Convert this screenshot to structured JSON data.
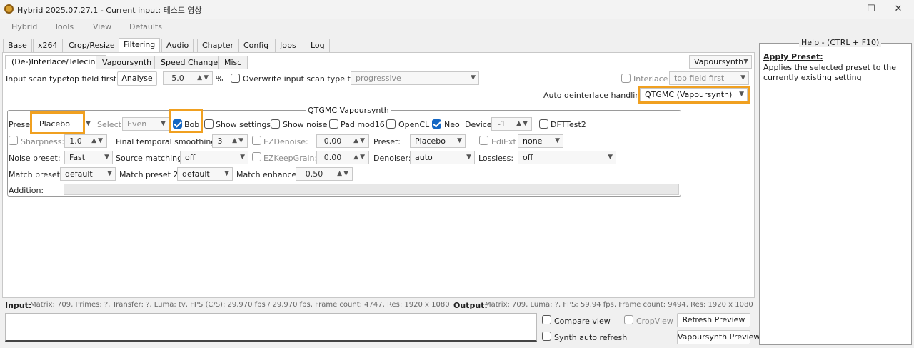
{
  "window": {
    "title": "Hybrid 2025.07.27.1 - Current input: 테스트 영상",
    "minimize": "—",
    "maximize": "☐",
    "close": "✕"
  },
  "menu": [
    "Hybrid",
    "Tools",
    "View",
    "Defaults"
  ],
  "main_tabs": [
    "Base",
    "x264",
    "Crop/Resize",
    "Filtering",
    "Audio",
    "Chapter",
    "Config",
    "Jobs",
    "Log"
  ],
  "sub_tabs": [
    "(De-)Interlace/Telecine",
    "Vapoursynth",
    "Speed Change",
    "Misc"
  ],
  "engine_select": "Vapoursynth",
  "scan": {
    "label": "Input scan type:",
    "value": "top field first",
    "analyse": "Analyse",
    "pct": "5.0",
    "pct_unit": "%",
    "overwrite_label": "Overwrite input scan type to:",
    "overwrite_value": "progressive",
    "interlace_label": "Interlace",
    "interlace_value": "top field first"
  },
  "auto": {
    "label": "Auto deinterlace handling:",
    "value": "QTGMC (Vapoursynth)"
  },
  "qtgmc": {
    "title": "QTGMC Vapoursynth",
    "preset_label": "Preset",
    "preset_value": "Placebo",
    "select_label": "Select:",
    "select_value": "Even",
    "bob": "Bob",
    "show_settings": "Show settings",
    "show_noise": "Show noise",
    "pad": "Pad mod16",
    "opencl": "OpenCL",
    "neo": "Neo",
    "device_label": "Device:",
    "device_value": "-1",
    "dfttest": "DFTTest2",
    "sharpness_label": "Sharpness:",
    "sharpness_value": "1.0",
    "fts_label": "Final temporal smoothing:",
    "fts_value": "3",
    "ezdenoise_label": "EZDenoise:",
    "ezdenoise_value": "0.00",
    "preset2_label": "Preset:",
    "preset2_value": "Placebo",
    "ediext_label": "EdiExt",
    "ediext_value": "none",
    "noise_label": "Noise preset:",
    "noise_value": "Fast",
    "source_label": "Source matching:",
    "source_value": "off",
    "ezkeep_label": "EZKeepGrain:",
    "ezkeep_value": "0.00",
    "denoiser_label": "Denoiser:",
    "denoiser_value": "auto",
    "lossless_label": "Lossless:",
    "lossless_value": "off",
    "match_label": "Match preset:",
    "match_value": "default",
    "match2_label": "Match preset 2:",
    "match2_value": "default",
    "enhance_label": "Match enhance:",
    "enhance_value": "0.50",
    "addition_label": "Addition:"
  },
  "status": {
    "input_label": "Input:",
    "input_text": "Matrix: 709, Primes: ?, Transfer: ?, Luma: tv, FPS (C/S): 29.970 fps / 29.970 fps, Frame count: 4747, Res: 1920 x 1080",
    "output_label": "Output:",
    "output_text": "Matrix: 709, Luma: ?, FPS: 59.94 fps, Frame count: 9494, Res: 1920 x 1080"
  },
  "preview": {
    "compare": "Compare view",
    "cropview": "CropView",
    "refresh": "Refresh Preview",
    "synth": "Synth auto refresh",
    "vs_preview": "Vapoursynth Preview"
  },
  "help": {
    "title": "Help - (CTRL + F10)",
    "heading": "Apply Preset:",
    "body": "Applies the selected preset to the currently existing setting"
  },
  "colors": {
    "highlight": "#f0a020",
    "check": "#1467c4"
  }
}
